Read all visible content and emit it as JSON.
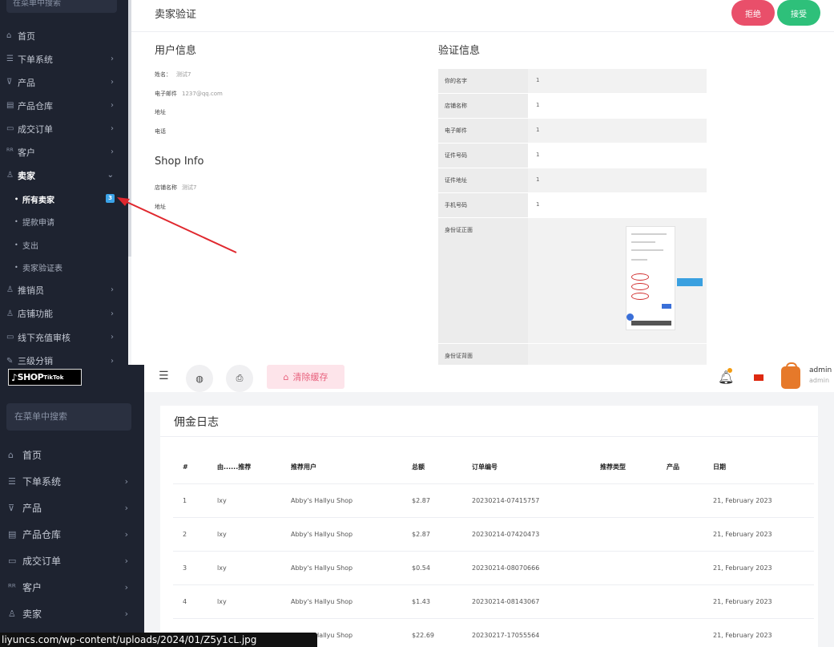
{
  "top": {
    "sidebar": {
      "search_placeholder": "在菜单中搜索",
      "items": [
        {
          "icon": "home-icon",
          "glyph": "⌂",
          "label": "首页",
          "chevron": ""
        },
        {
          "icon": "list-icon",
          "glyph": "☰",
          "label": "下单系统",
          "chevron": "›"
        },
        {
          "icon": "cart-icon",
          "glyph": "⊽",
          "label": "产品",
          "chevron": "›"
        },
        {
          "icon": "warehouse-icon",
          "glyph": "▤",
          "label": "产品仓库",
          "chevron": "›"
        },
        {
          "icon": "orders-icon",
          "glyph": "▭",
          "label": "成交订单",
          "chevron": "›"
        },
        {
          "icon": "customers-icon",
          "glyph": "ᴿᴿ",
          "label": "客户",
          "chevron": "›"
        },
        {
          "icon": "seller-icon",
          "glyph": "♙",
          "label": "卖家",
          "chevron": "⌄"
        }
      ],
      "sub_items": [
        {
          "label": "所有卖家",
          "badge": "3"
        },
        {
          "label": "提款申请",
          "badge": ""
        },
        {
          "label": "支出",
          "badge": ""
        },
        {
          "label": "卖家验证表",
          "badge": ""
        }
      ],
      "items_after": [
        {
          "icon": "promoter-icon",
          "glyph": "♙",
          "label": "推销员",
          "chevron": "›"
        },
        {
          "icon": "store-icon",
          "glyph": "♙",
          "label": "店铺功能",
          "chevron": "›"
        },
        {
          "icon": "recharge-icon",
          "glyph": "▭",
          "label": "线下充值审核",
          "chevron": "›"
        },
        {
          "icon": "tier-icon",
          "glyph": "✎",
          "label": "三级分销",
          "chevron": "›"
        }
      ]
    },
    "page_title": "卖家验证",
    "reject_label": "拒绝",
    "accept_label": "接受",
    "user_info": {
      "title": "用户信息",
      "fields": [
        {
          "label": "姓名：",
          "value": "测试7"
        },
        {
          "label": "电子邮件",
          "value": "1237@qq.com"
        },
        {
          "label": "地址",
          "value": ""
        },
        {
          "label": "电话",
          "value": ""
        }
      ]
    },
    "shop_info": {
      "title": "Shop Info",
      "fields": [
        {
          "label": "店铺名称",
          "value": "测试7"
        },
        {
          "label": "地址",
          "value": ""
        }
      ]
    },
    "verify": {
      "title": "验证信息",
      "rows": [
        {
          "label": "你的名字",
          "value": "1"
        },
        {
          "label": "店铺名称",
          "value": "1"
        },
        {
          "label": "电子邮件",
          "value": "1"
        },
        {
          "label": "证件号码",
          "value": "1"
        },
        {
          "label": "证件地址",
          "value": "1"
        },
        {
          "label": "手机号码",
          "value": "1"
        }
      ],
      "id_front_label": "身份证正面",
      "id_back_label": "身份证背面"
    }
  },
  "bottom": {
    "logo_shop": "SHOP",
    "logo_tiktok": "TikTok",
    "sidebar": {
      "search_placeholder": "在菜单中搜索",
      "items": [
        {
          "icon": "home-icon",
          "glyph": "⌂",
          "label": "首页",
          "chevron": ""
        },
        {
          "icon": "list-icon",
          "glyph": "☰",
          "label": "下单系统",
          "chevron": "›"
        },
        {
          "icon": "cart-icon",
          "glyph": "⊽",
          "label": "产品",
          "chevron": "›"
        },
        {
          "icon": "warehouse-icon",
          "glyph": "▤",
          "label": "产品仓库",
          "chevron": "›"
        },
        {
          "icon": "orders-icon",
          "glyph": "▭",
          "label": "成交订单",
          "chevron": "›"
        },
        {
          "icon": "customers-icon",
          "glyph": "ᴿᴿ",
          "label": "客户",
          "chevron": "›"
        },
        {
          "icon": "seller-icon",
          "glyph": "♙",
          "label": "卖家",
          "chevron": "›"
        }
      ]
    },
    "toolbar": {
      "clear_cache_label": "清除缓存",
      "admin_name": "admin",
      "admin_role": "admin"
    },
    "commission": {
      "title": "佣金日志",
      "headers": [
        "#",
        "由......推荐",
        "推荐用户",
        "总额",
        "订单编号",
        "推荐类型",
        "产品",
        "日期"
      ],
      "rows": [
        [
          "1",
          "lxy",
          "Abby's Hallyu Shop",
          "$2.87",
          "20230214-07415757",
          "",
          "",
          "21, February 2023"
        ],
        [
          "2",
          "lxy",
          "Abby's Hallyu Shop",
          "$2.87",
          "20230214-07420473",
          "",
          "",
          "21, February 2023"
        ],
        [
          "3",
          "lxy",
          "Abby's Hallyu Shop",
          "$0.54",
          "20230214-08070666",
          "",
          "",
          "21, February 2023"
        ],
        [
          "4",
          "lxy",
          "Abby's Hallyu Shop",
          "$1.43",
          "20230214-08143067",
          "",
          "",
          "21, February 2023"
        ],
        [
          "5",
          "lxy",
          "Abby's Hallyu Shop",
          "$22.69",
          "20230217-17055564",
          "",
          "",
          "21, February 2023"
        ]
      ]
    }
  },
  "status_url": "liyuncs.com/wp-content/uploads/2024/01/Z5y1cL.jpg"
}
